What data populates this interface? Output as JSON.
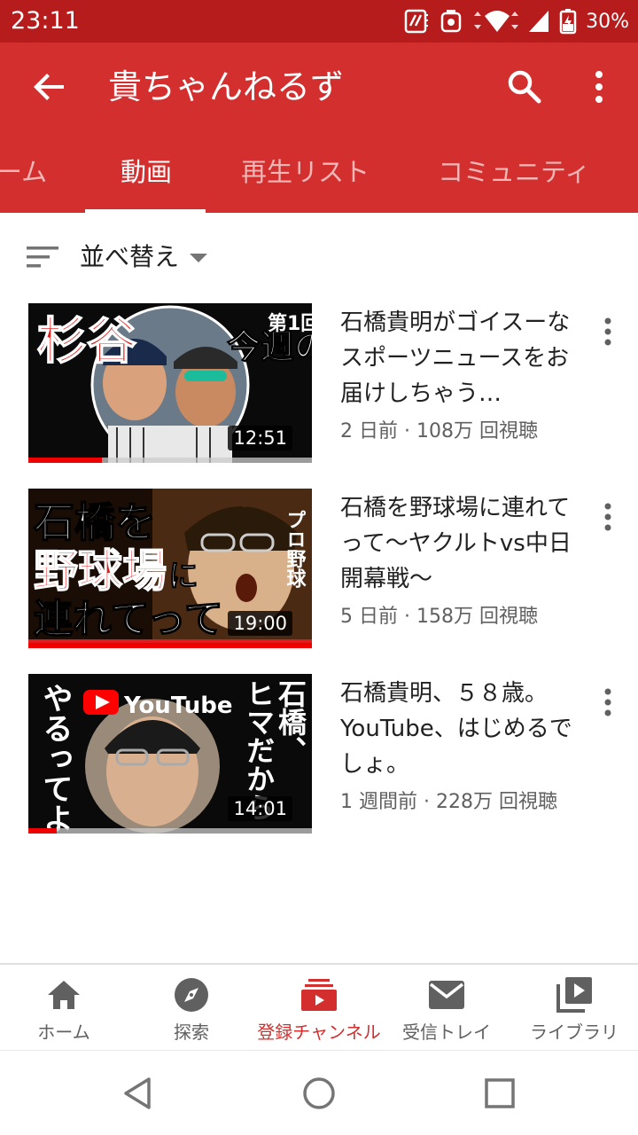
{
  "status_bar": {
    "time": "23:11",
    "battery": "30%"
  },
  "app_bar": {
    "title": "貴ちゃんねるず",
    "tabs": [
      {
        "label": "ーム"
      },
      {
        "label": "動画"
      },
      {
        "label": "再生リスト"
      },
      {
        "label": "コミュニティ"
      }
    ],
    "active_tab": 1
  },
  "sort": {
    "label": "並べ替え"
  },
  "videos": [
    {
      "title": "石橋貴明がゴイスーなスポーツニュースをお届けしちゃう…",
      "meta": "2 日前 · 108万 回視聴",
      "duration": "12:51",
      "watched_fraction": 0.26,
      "thumb_text": {
        "left": "杉谷",
        "right": "今週の",
        "badge": "第1回"
      }
    },
    {
      "title": "石橋を野球場に連れてって〜ヤクルトvs中日開幕戦〜",
      "meta": "5 日前 · 158万 回視聴",
      "duration": "19:00",
      "watched_fraction": 1.0,
      "thumb_text": {
        "line1": "石橋を",
        "line2": "野球場",
        "line2b": "に",
        "line3": "連れてって",
        "side": "プロ野球"
      }
    },
    {
      "title": "石橋貴明、５８歳。YouTube、はじめるでしょ。",
      "meta": "1 週間前 · 228万 回視聴",
      "duration": "14:01",
      "watched_fraction": 0.1,
      "thumb_text": {
        "left": "やるってよ",
        "brand": "YouTube",
        "right1": "石橋、",
        "right2": "ヒマだから"
      }
    }
  ],
  "bottom_nav": [
    {
      "label": "ホーム",
      "icon": "home-icon"
    },
    {
      "label": "探索",
      "icon": "explore-icon"
    },
    {
      "label": "登録チャンネル",
      "icon": "subscriptions-icon"
    },
    {
      "label": "受信トレイ",
      "icon": "inbox-icon"
    },
    {
      "label": "ライブラリ",
      "icon": "library-icon"
    }
  ],
  "bottom_nav_active": 2,
  "colors": {
    "status_bar": "#b71c1c",
    "app_bar": "#d32f2f",
    "accent": "#d32f2f",
    "progress": "#ee0000"
  }
}
